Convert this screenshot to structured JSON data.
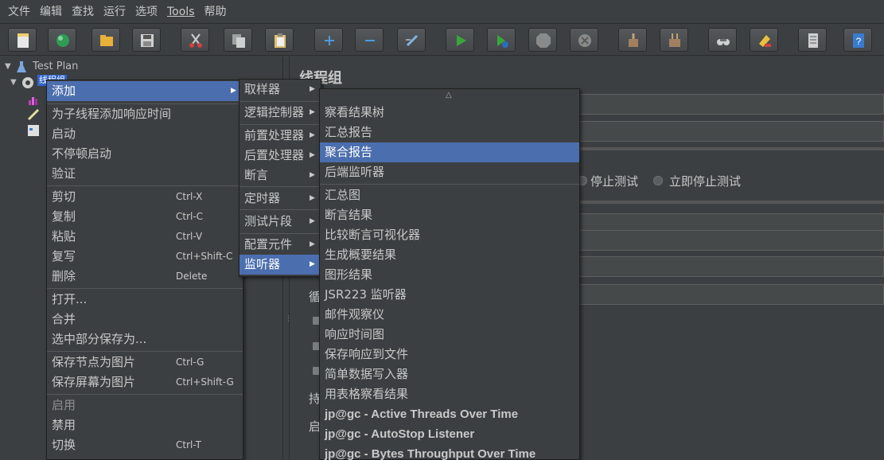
{
  "menubar": {
    "items": [
      "文件",
      "编辑",
      "查找",
      "运行",
      "选项",
      "Tools",
      "帮助"
    ]
  },
  "toolbar": {
    "buttons": [
      {
        "name": "new-icon",
        "color": "#e8e8e8"
      },
      {
        "name": "templates-icon",
        "color": "#2e9c52"
      },
      {
        "name": "open-icon",
        "color": "#e8b13a"
      },
      {
        "name": "save-icon",
        "color": "#cfcfcf"
      },
      {
        "name": "cut-icon",
        "color": "#d04040"
      },
      {
        "name": "copy-icon",
        "color": "#d0d0d0"
      },
      {
        "name": "paste-icon",
        "color": "#e0c070"
      },
      {
        "name": "expand-icon",
        "color": "#4b9ae0"
      },
      {
        "name": "collapse-icon",
        "color": "#4b9ae0"
      },
      {
        "name": "toggle-icon",
        "color": "#7fb4e0"
      },
      {
        "name": "start-icon",
        "color": "#3aa63a"
      },
      {
        "name": "start-no-pauses-icon",
        "color": "#3aa63a"
      },
      {
        "name": "stop-icon",
        "color": "#8a8a8a"
      },
      {
        "name": "shutdown-icon",
        "color": "#8a8a8a"
      },
      {
        "name": "clear-icon",
        "color": "#a08060"
      },
      {
        "name": "clear-all-icon",
        "color": "#a08060"
      },
      {
        "name": "search-icon",
        "color": "#d0d0d0"
      },
      {
        "name": "reset-search-icon",
        "color": "#e8c040"
      },
      {
        "name": "function-helper-icon",
        "color": "#d0d0d0"
      },
      {
        "name": "help-icon",
        "color": "#3a7bd0"
      }
    ]
  },
  "tree": {
    "root": "Test Plan",
    "selected": "线程组"
  },
  "right_panel": {
    "title": "线程组",
    "stop_test": "停止测试",
    "stop_test_now": "立即停止测试",
    "loop_label": "循",
    "duration_label": "持",
    "delay_label": "启"
  },
  "context_menu": {
    "items": [
      {
        "label": "添加",
        "selected": true,
        "submenu": true
      },
      {
        "label": "为子线程添加响应时间"
      },
      {
        "label": "启动"
      },
      {
        "label": "不停顿启动"
      },
      {
        "label": "验证"
      },
      {
        "label": "剪切",
        "shortcut": "Ctrl-X"
      },
      {
        "label": "复制",
        "shortcut": "Ctrl-C"
      },
      {
        "label": "粘贴",
        "shortcut": "Ctrl-V"
      },
      {
        "label": "复写",
        "shortcut": "Ctrl+Shift-C"
      },
      {
        "label": "删除",
        "shortcut": "Delete"
      },
      {
        "label": "打开..."
      },
      {
        "label": "合并"
      },
      {
        "label": "选中部分保存为..."
      },
      {
        "label": "保存节点为图片",
        "shortcut": "Ctrl-G"
      },
      {
        "label": "保存屏幕为图片",
        "shortcut": "Ctrl+Shift-G"
      },
      {
        "label": "启用",
        "disabled": true
      },
      {
        "label": "禁用"
      },
      {
        "label": "切换",
        "shortcut": "Ctrl-T"
      }
    ]
  },
  "add_menu": {
    "items": [
      {
        "label": "取样器"
      },
      {
        "label": "逻辑控制器"
      },
      {
        "label": "前置处理器"
      },
      {
        "label": "后置处理器"
      },
      {
        "label": "断言"
      },
      {
        "label": "定时器"
      },
      {
        "label": "测试片段"
      },
      {
        "label": "配置元件"
      },
      {
        "label": "监听器",
        "selected": true
      }
    ]
  },
  "listener_menu": {
    "items": [
      {
        "label": "察看结果树"
      },
      {
        "label": "汇总报告"
      },
      {
        "label": "聚合报告",
        "selected": true
      },
      {
        "label": "后端监听器"
      },
      {
        "label": "汇总图"
      },
      {
        "label": "断言结果"
      },
      {
        "label": "比较断言可视化器"
      },
      {
        "label": "生成概要结果"
      },
      {
        "label": "图形结果"
      },
      {
        "label": "JSR223 监听器"
      },
      {
        "label": "邮件观察仪"
      },
      {
        "label": "响应时间图"
      },
      {
        "label": "保存响应到文件"
      },
      {
        "label": "简单数据写入器"
      },
      {
        "label": "用表格察看结果"
      },
      {
        "label": "jp@gc - Active Threads Over Time"
      },
      {
        "label": "jp@gc - AutoStop Listener"
      },
      {
        "label": "jp@gc - Bytes Throughput Over Time"
      }
    ]
  }
}
